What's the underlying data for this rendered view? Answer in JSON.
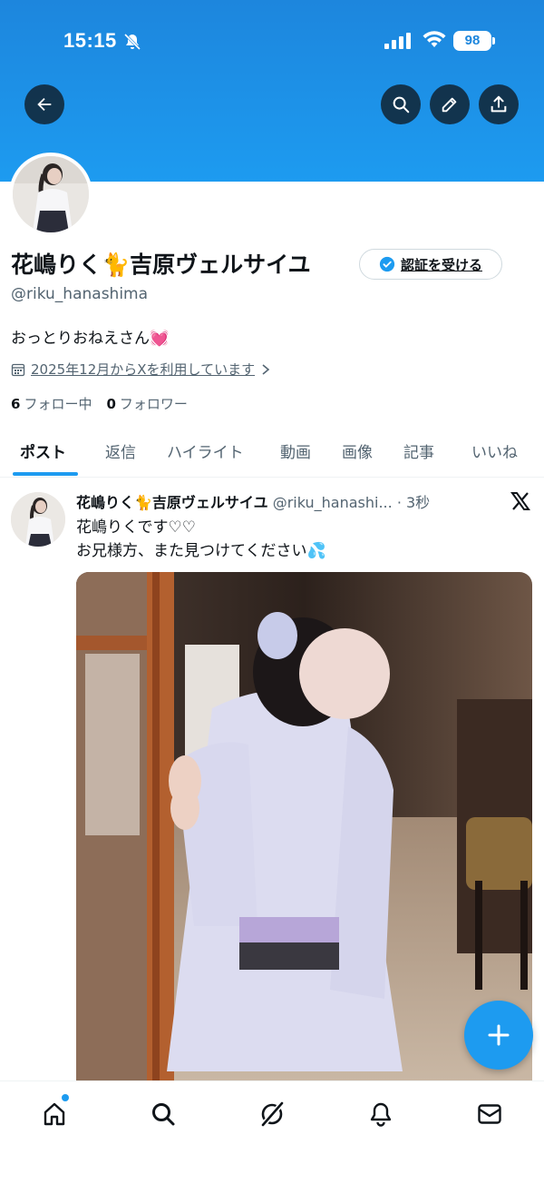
{
  "status_bar": {
    "time": "15:15",
    "battery": "98"
  },
  "profile": {
    "display_name": "花嶋りく🐈吉原ヴェルサイユ",
    "handle": "@riku_hanashima",
    "verify_label": "認証を受ける",
    "bio": "おっとりおねえさん💓",
    "joined": "2025年12月からXを利用しています",
    "following_count": "6",
    "following_label": "フォロー中",
    "followers_count": "0",
    "followers_label": "フォロワー"
  },
  "tabs": [
    {
      "label": "ポスト"
    },
    {
      "label": "返信"
    },
    {
      "label": "ハイライト"
    },
    {
      "label": "動画"
    },
    {
      "label": "画像"
    },
    {
      "label": "記事"
    },
    {
      "label": "いいね"
    }
  ],
  "post": {
    "author_name": "花嶋りく🐈吉原ヴェルサイユ",
    "author_handle": "@riku_hanashi...",
    "time_ago": "· 3秒",
    "text_line1": "花嶋りくです♡♡",
    "text_line2": "お兄様方、また見つけてください💦"
  },
  "icons": {
    "back": "arrow-left-icon",
    "search": "search-icon",
    "edit": "pencil-icon",
    "share": "share-icon",
    "compose": "plus-icon",
    "nav": [
      "home-icon",
      "search-icon",
      "grok-icon",
      "bell-icon",
      "mail-icon"
    ]
  },
  "colors": {
    "accent": "#1d9bf0",
    "banner": "#1d86dd",
    "text": "#0f1419",
    "muted": "#536471"
  }
}
